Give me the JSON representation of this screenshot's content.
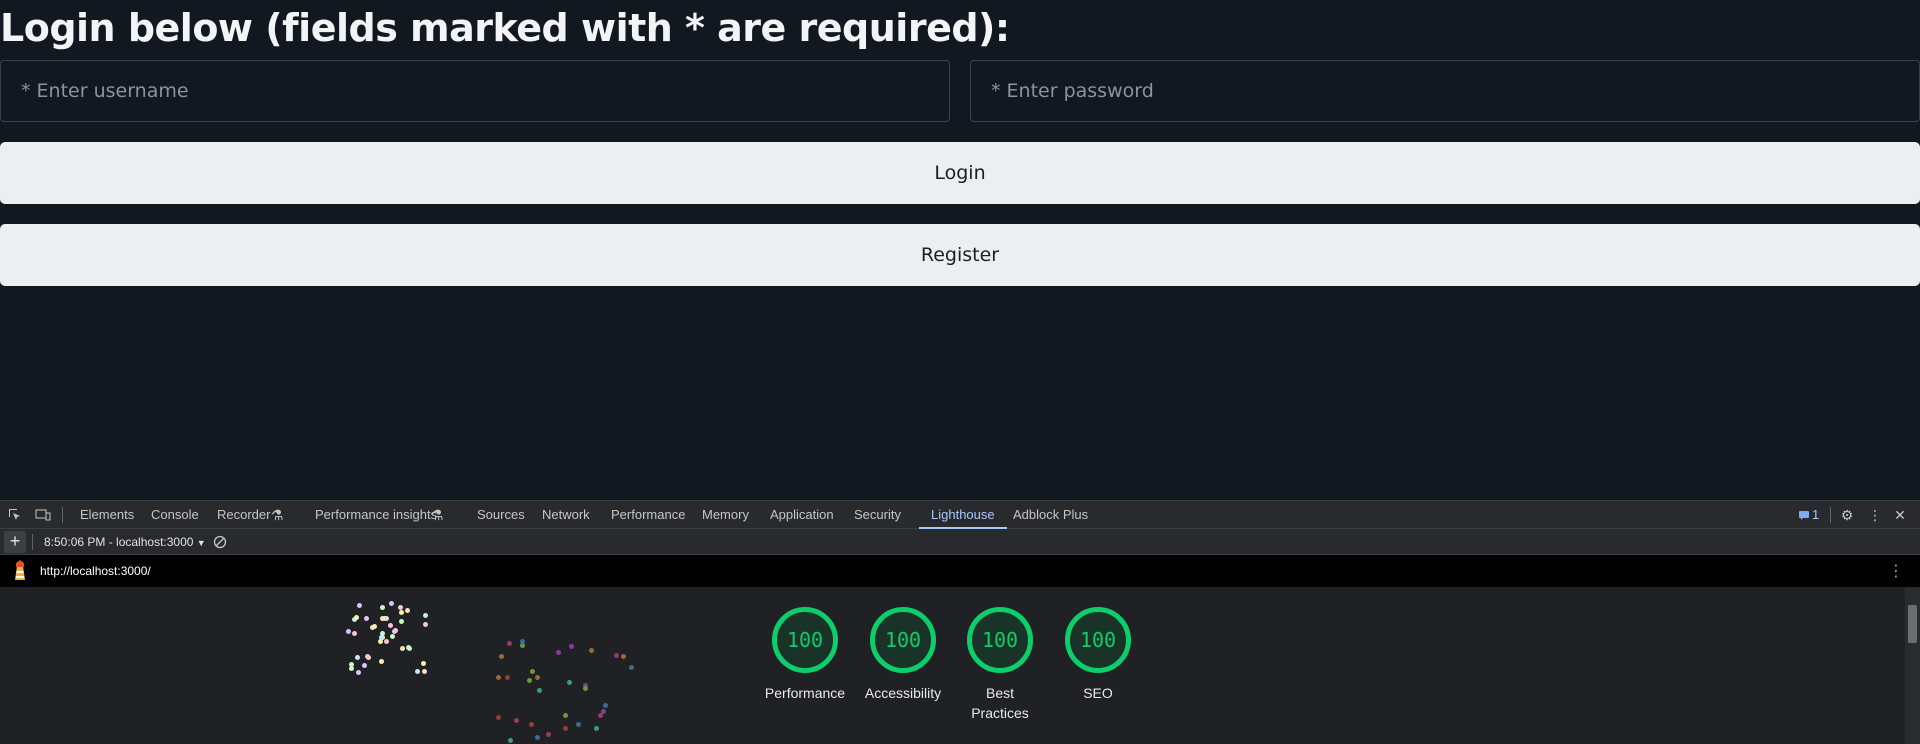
{
  "page": {
    "heading": "Login below (fields marked with * are required):",
    "username_placeholder": "* Enter username",
    "password_placeholder": "* Enter password",
    "login_label": "Login",
    "register_label": "Register"
  },
  "devtools": {
    "tabs": [
      {
        "label": "Elements"
      },
      {
        "label": "Console"
      },
      {
        "label": "Recorder"
      },
      {
        "label": "Performance insights"
      },
      {
        "label": "Sources"
      },
      {
        "label": "Network"
      },
      {
        "label": "Performance"
      },
      {
        "label": "Memory"
      },
      {
        "label": "Application"
      },
      {
        "label": "Security"
      },
      {
        "label": "Lighthouse"
      },
      {
        "label": "Adblock Plus"
      }
    ],
    "active_tab": "Lighthouse",
    "issues_count": "1",
    "report_selector": "8:50:06 PM - localhost:3000",
    "url": "http://localhost:3000/"
  },
  "lighthouse": {
    "scores": [
      {
        "value": "100",
        "label": "Performance"
      },
      {
        "value": "100",
        "label": "Accessibility"
      },
      {
        "value": "100",
        "label": "Best Practices"
      },
      {
        "value": "100",
        "label": "SEO"
      }
    ],
    "pass_color": "#0cce6b"
  },
  "colors": {
    "background": "#121820",
    "button_bg": "#eceff2",
    "devtools_accent": "#a8c7fa"
  }
}
